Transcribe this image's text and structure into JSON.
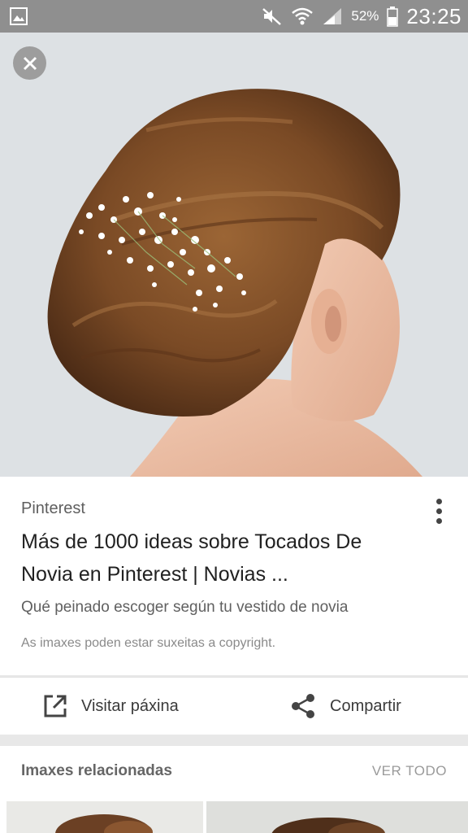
{
  "status_bar": {
    "battery_percent": "52%",
    "time": "23:25",
    "icons": [
      "gallery-icon",
      "mute-icon",
      "wifi-icon",
      "signal-icon",
      "battery-icon"
    ]
  },
  "hero": {
    "description_icon": "bridal-hair-photo"
  },
  "result": {
    "source": "Pinterest",
    "title": "Más de 1000 ideas sobre Tocados De Novia en Pinterest | Novias ...",
    "snippet": "Qué peinado escoger según tu vestido de novia",
    "copyright_note": "As imaxes poden estar suxeitas a copyright."
  },
  "actions": {
    "visit_label": "Visitar páxina",
    "share_label": "Compartir"
  },
  "related": {
    "title": "Imaxes relacionadas",
    "see_all": "VER TODO"
  },
  "colors": {
    "status_bar": "#8f8f8f",
    "card_bg": "#ffffff",
    "page_bg": "#e8e8e8",
    "hair": "#7a4a25"
  }
}
